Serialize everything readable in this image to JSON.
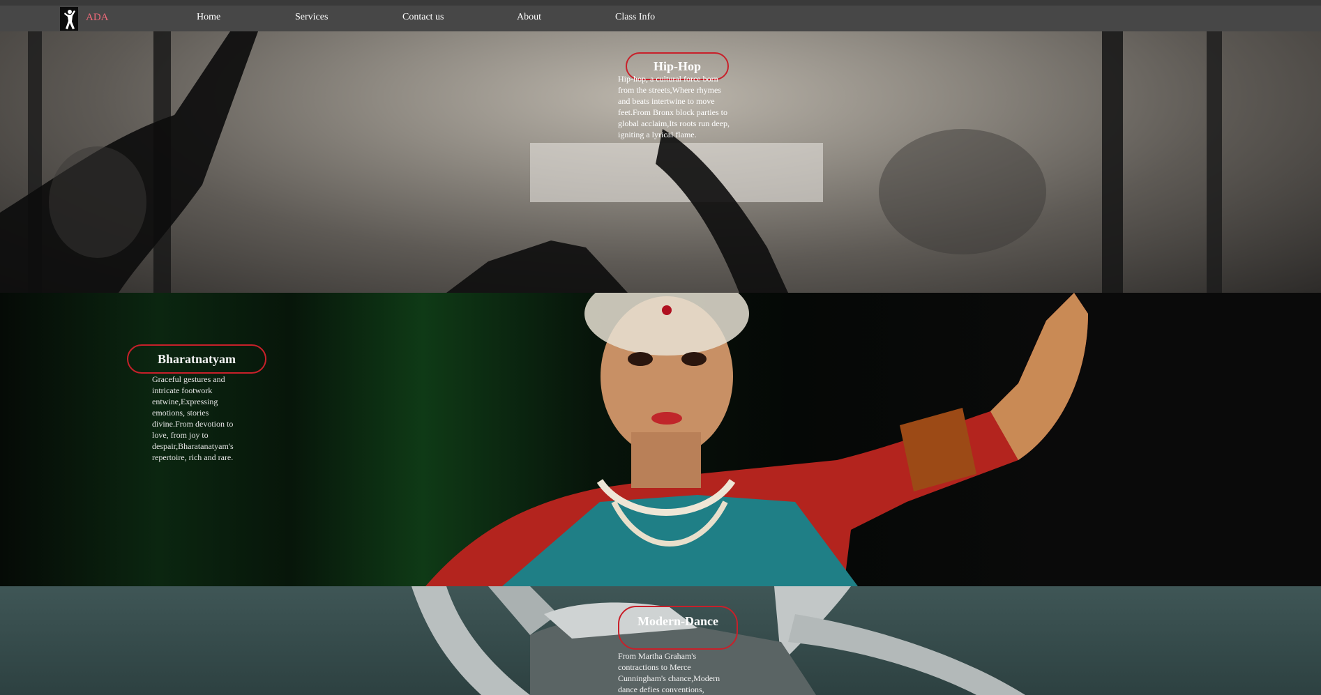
{
  "nav": {
    "brand": "ADA",
    "items": [
      "Home",
      "Services",
      "Contact us",
      "About",
      "Class Info"
    ]
  },
  "sections": [
    {
      "title": "Hip-Hop",
      "description": "Hip-hop, a cultural force born from the streets,Where rhymes and beats intertwine to move feet.From Bronx block parties to global acclaim,Its roots run deep, igniting a lyrical flame."
    },
    {
      "title": "Bharatnatyam",
      "description": "Graceful gestures and intricate footwork entwine,Expressing emotions, stories divine.From devotion to love, from joy to despair,Bharatanatyam's repertoire, rich and rare."
    },
    {
      "title": "Modern-Dance",
      "description": "From Martha Graham's contractions to Merce Cunningham's chance,Modern dance defies conventions,"
    }
  ],
  "colors": {
    "navbar": "#474747",
    "brand": "#f06a7a",
    "pill_border": "#c8202a"
  }
}
